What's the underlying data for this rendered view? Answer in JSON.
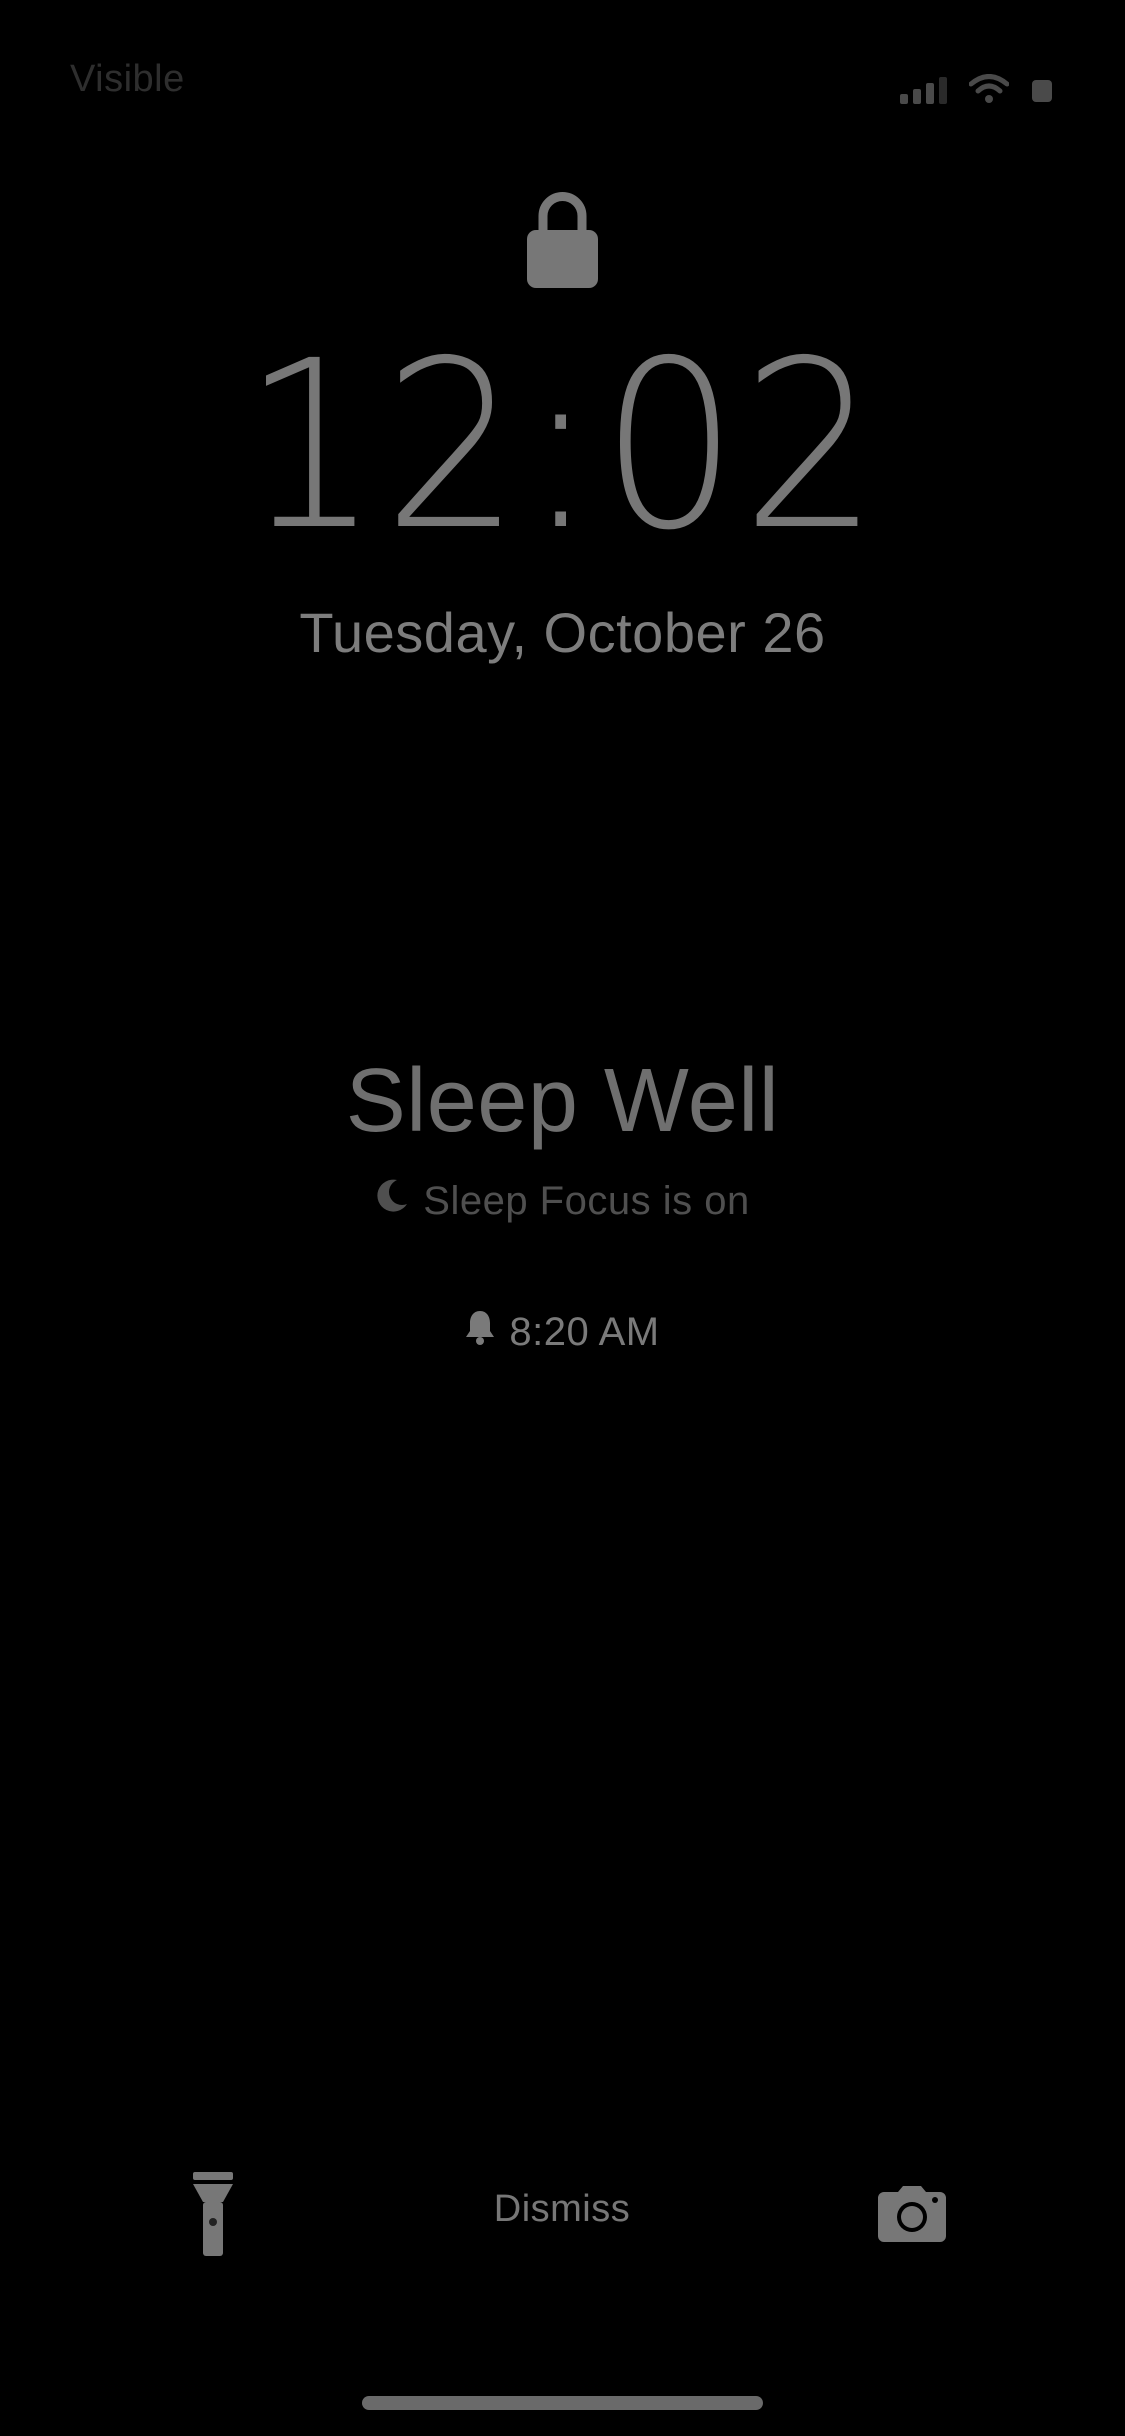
{
  "status_bar": {
    "carrier": "Visible",
    "icons": [
      "signal-icon",
      "wifi-icon",
      "battery-icon"
    ]
  },
  "lock_screen": {
    "lock_icon": "lock-icon",
    "time": "12:02",
    "date": "Tuesday, October 26"
  },
  "sleep": {
    "title": "Sleep Well",
    "focus_icon": "moon-icon",
    "focus_status": "Sleep Focus is on",
    "alarm_icon": "bell-icon",
    "alarm_time": "8:20 AM"
  },
  "bottom_bar": {
    "flashlight_icon": "flashlight-icon",
    "dismiss_label": "Dismiss",
    "camera_icon": "camera-icon"
  },
  "colors": {
    "background": "#000000",
    "foreground": "#777777",
    "dim_text": "#4f4f4f"
  }
}
